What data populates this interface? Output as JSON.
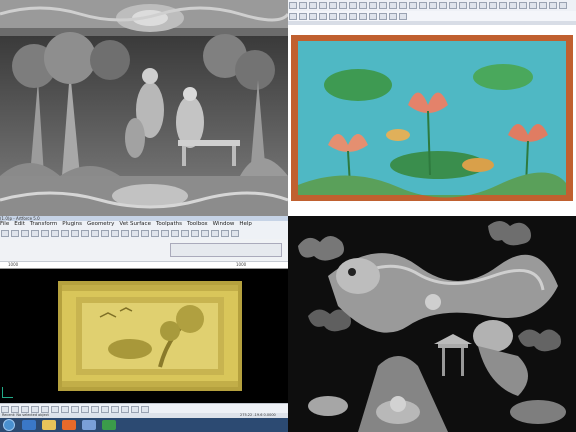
{
  "panels": {
    "relief_forest_scene": {
      "description_visible": false
    },
    "lotus_carving": {},
    "artcam_window": {
      "title": "ArtCAM - Art3d",
      "title_short": "(1.0)p - Artforce 5.0",
      "menu": [
        "File",
        "Edit",
        "Transform",
        "Plugins",
        "Geometry",
        "Vet Surface",
        "Toolpaths",
        "Toolbox",
        "Window",
        "Help"
      ],
      "ruler_left": "1000",
      "ruler_right": "1000",
      "status_left": "Recent: No selected object",
      "status_right": "275.22 -19.6 0.0000"
    },
    "dragon_relief": {}
  },
  "colors": {
    "lotus_bg": "#4fb8c4",
    "lotus_frame": "#c0602f",
    "panel_gold": "#d9c65a",
    "relief_gray": "#8a8a8a",
    "taskbar": "#2c4a72"
  },
  "icons": [
    "select-icon",
    "rectangle-icon",
    "circle-icon",
    "polyline-icon",
    "zoom-icon",
    "windows-start-icon",
    "ie-icon",
    "folder-icon",
    "media-icon",
    "artcam-icon"
  ]
}
